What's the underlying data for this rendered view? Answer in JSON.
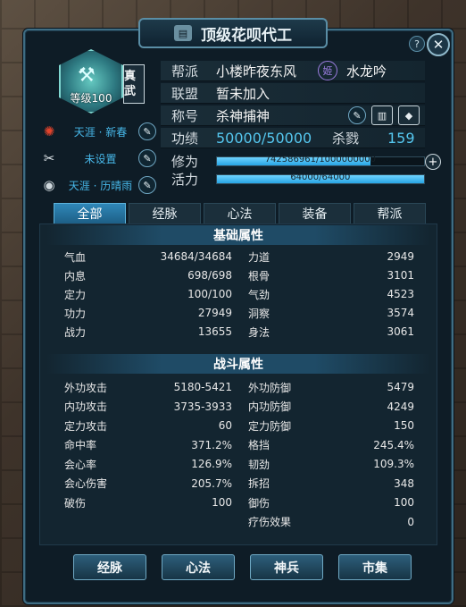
{
  "window": {
    "title": "顶级花呗代工",
    "title_icon": "scroll-icon"
  },
  "controls": {
    "help": "?",
    "close": "✕"
  },
  "avatar": {
    "level_text": "等级100",
    "badge": "真武"
  },
  "side": [
    {
      "icon": "knot-icon",
      "text": "天涯 · 新春"
    },
    {
      "icon": "scissors-icon",
      "text": "未设置"
    },
    {
      "icon": "portrait-icon",
      "text": "天涯 · 历晴雨"
    }
  ],
  "info": {
    "faction_label": "帮派",
    "faction_value": "小楼昨夜东风",
    "spouse_tag": "姬",
    "spouse_name": "水龙吟",
    "alliance_label": "联盟",
    "alliance_value": "暂未加入",
    "title_label": "称号",
    "title_value": "杀神捕神",
    "merit_label": "功绩",
    "merit_value": "50000/50000",
    "kills_label": "杀戮",
    "kills_value": "159",
    "cultivation_label": "修为",
    "cultivation_text": "742586961/1000000000",
    "vitality_label": "活力",
    "vitality_text": "64000/64000"
  },
  "bars": {
    "cultivation_fraction": 0.7426,
    "vitality_fraction": 1.0
  },
  "tabs": [
    "全部",
    "经脉",
    "心法",
    "装备",
    "帮派"
  ],
  "basic_header": "基础属性",
  "basic_left": [
    {
      "k": "气血",
      "v": "34684/34684"
    },
    {
      "k": "内息",
      "v": "698/698"
    },
    {
      "k": "定力",
      "v": "100/100"
    },
    {
      "k": "功力",
      "v": "27949"
    },
    {
      "k": "战力",
      "v": "13655"
    }
  ],
  "basic_right": [
    {
      "k": "力道",
      "v": "2949"
    },
    {
      "k": "根骨",
      "v": "3101"
    },
    {
      "k": "气劲",
      "v": "4523"
    },
    {
      "k": "洞察",
      "v": "3574"
    },
    {
      "k": "身法",
      "v": "3061"
    }
  ],
  "combat_header": "战斗属性",
  "combat_left": [
    {
      "k": "外功攻击",
      "v": "5180-5421"
    },
    {
      "k": "内功攻击",
      "v": "3735-3933"
    },
    {
      "k": "定力攻击",
      "v": "60"
    },
    {
      "k": "命中率",
      "v": "371.2%"
    },
    {
      "k": "会心率",
      "v": "126.9%"
    },
    {
      "k": "会心伤害",
      "v": "205.7%"
    },
    {
      "k": "破伤",
      "v": "100"
    }
  ],
  "combat_right": [
    {
      "k": "外功防御",
      "v": "5479"
    },
    {
      "k": "内功防御",
      "v": "4249"
    },
    {
      "k": "定力防御",
      "v": "150"
    },
    {
      "k": "格挡",
      "v": "245.4%"
    },
    {
      "k": "韧劲",
      "v": "109.3%"
    },
    {
      "k": "拆招",
      "v": "348"
    },
    {
      "k": "御伤",
      "v": "100"
    },
    {
      "k": "疗伤效果",
      "v": "0"
    }
  ],
  "bottom_buttons": [
    "经脉",
    "心法",
    "神兵",
    "市集"
  ]
}
